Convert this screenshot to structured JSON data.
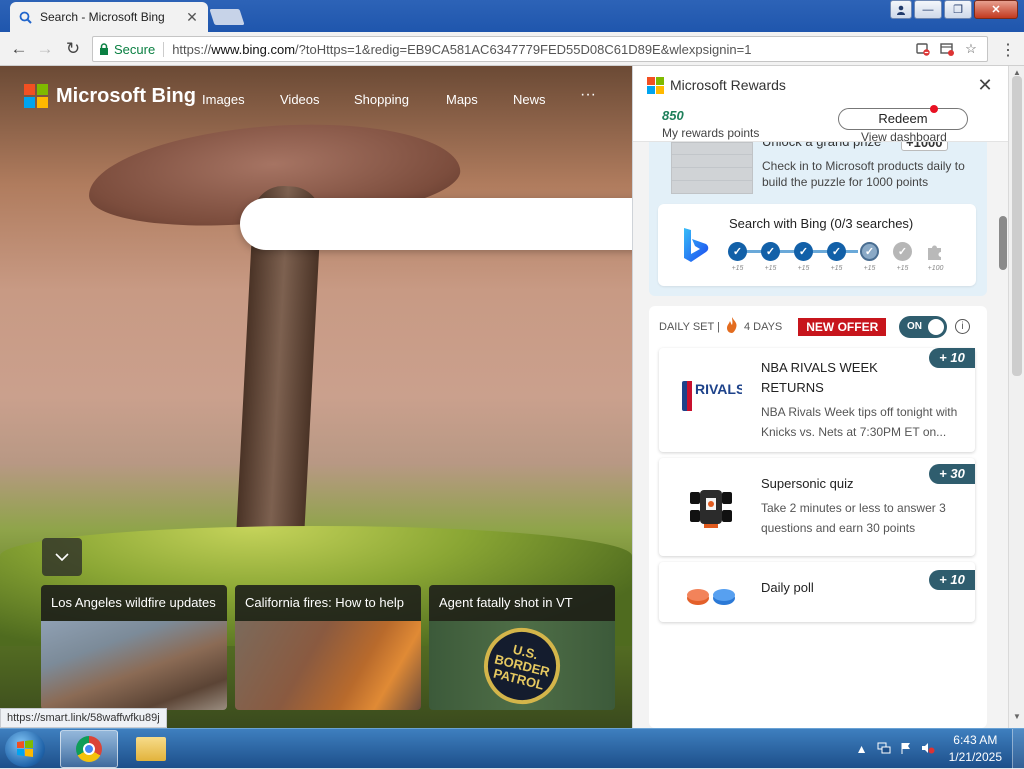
{
  "browser": {
    "tab_title": "Search - Microsoft Bing",
    "secure_label": "Secure",
    "url_scheme": "https://",
    "url_host": "www.bing.com",
    "url_rest": "/?toHttps=1&redig=EB9CA581AC6347779FED55D08C61D89E&wlexpsignin=1"
  },
  "bing": {
    "logo_text": "Microsoft Bing",
    "nav": [
      "Images",
      "Videos",
      "Shopping",
      "Maps",
      "News",
      "···"
    ],
    "news": [
      {
        "title": "Los Angeles wildfire updates"
      },
      {
        "title": "California fires: How to help"
      },
      {
        "title": "Agent fatally shot in VT"
      }
    ],
    "patch_text": "U.S. BORDER PATROL",
    "status_url": "https://smart.link/58waffwfku89j"
  },
  "rewards": {
    "title": "Microsoft Rewards",
    "points": "850",
    "points_label": "My rewards points",
    "redeem_label": "Redeem",
    "dashboard_label": "View dashboard",
    "puzzle": {
      "title": "Unlock a grand prize",
      "plus": "+1000",
      "desc": "Check in to Microsoft products daily to build the puzzle for 1000 points"
    },
    "search_card": {
      "title": "Search with Bing (0/3 searches)",
      "steps": [
        "+15",
        "+15",
        "+15",
        "+15",
        "+15",
        "+15",
        "+100"
      ]
    },
    "daily_set": {
      "label": "DAILY SET |",
      "streak": "4 DAYS",
      "new_offer": "NEW OFFER",
      "toggle": "ON",
      "info": "i"
    },
    "offers": [
      {
        "title": "NBA RIVALS WEEK RETURNS",
        "desc": "NBA Rivals Week tips off tonight with Knicks vs. Nets at 7:30PM ET on...",
        "badge": "+ 10",
        "logo": "RIVALS WEEK"
      },
      {
        "title": "Supersonic quiz",
        "desc": "Take 2 minutes or less to answer 3 questions and earn 30 points",
        "badge": "+ 30"
      },
      {
        "title": "Daily poll",
        "desc": "",
        "badge": "+ 10"
      }
    ]
  },
  "taskbar": {
    "time": "6:43 AM",
    "date": "1/21/2025"
  },
  "colors": {
    "tabstrip": "#2d63b7",
    "rewards_teal": "#2f5d6e",
    "new_offer_red": "#c7151c",
    "points_green": "#1d7f5a"
  }
}
